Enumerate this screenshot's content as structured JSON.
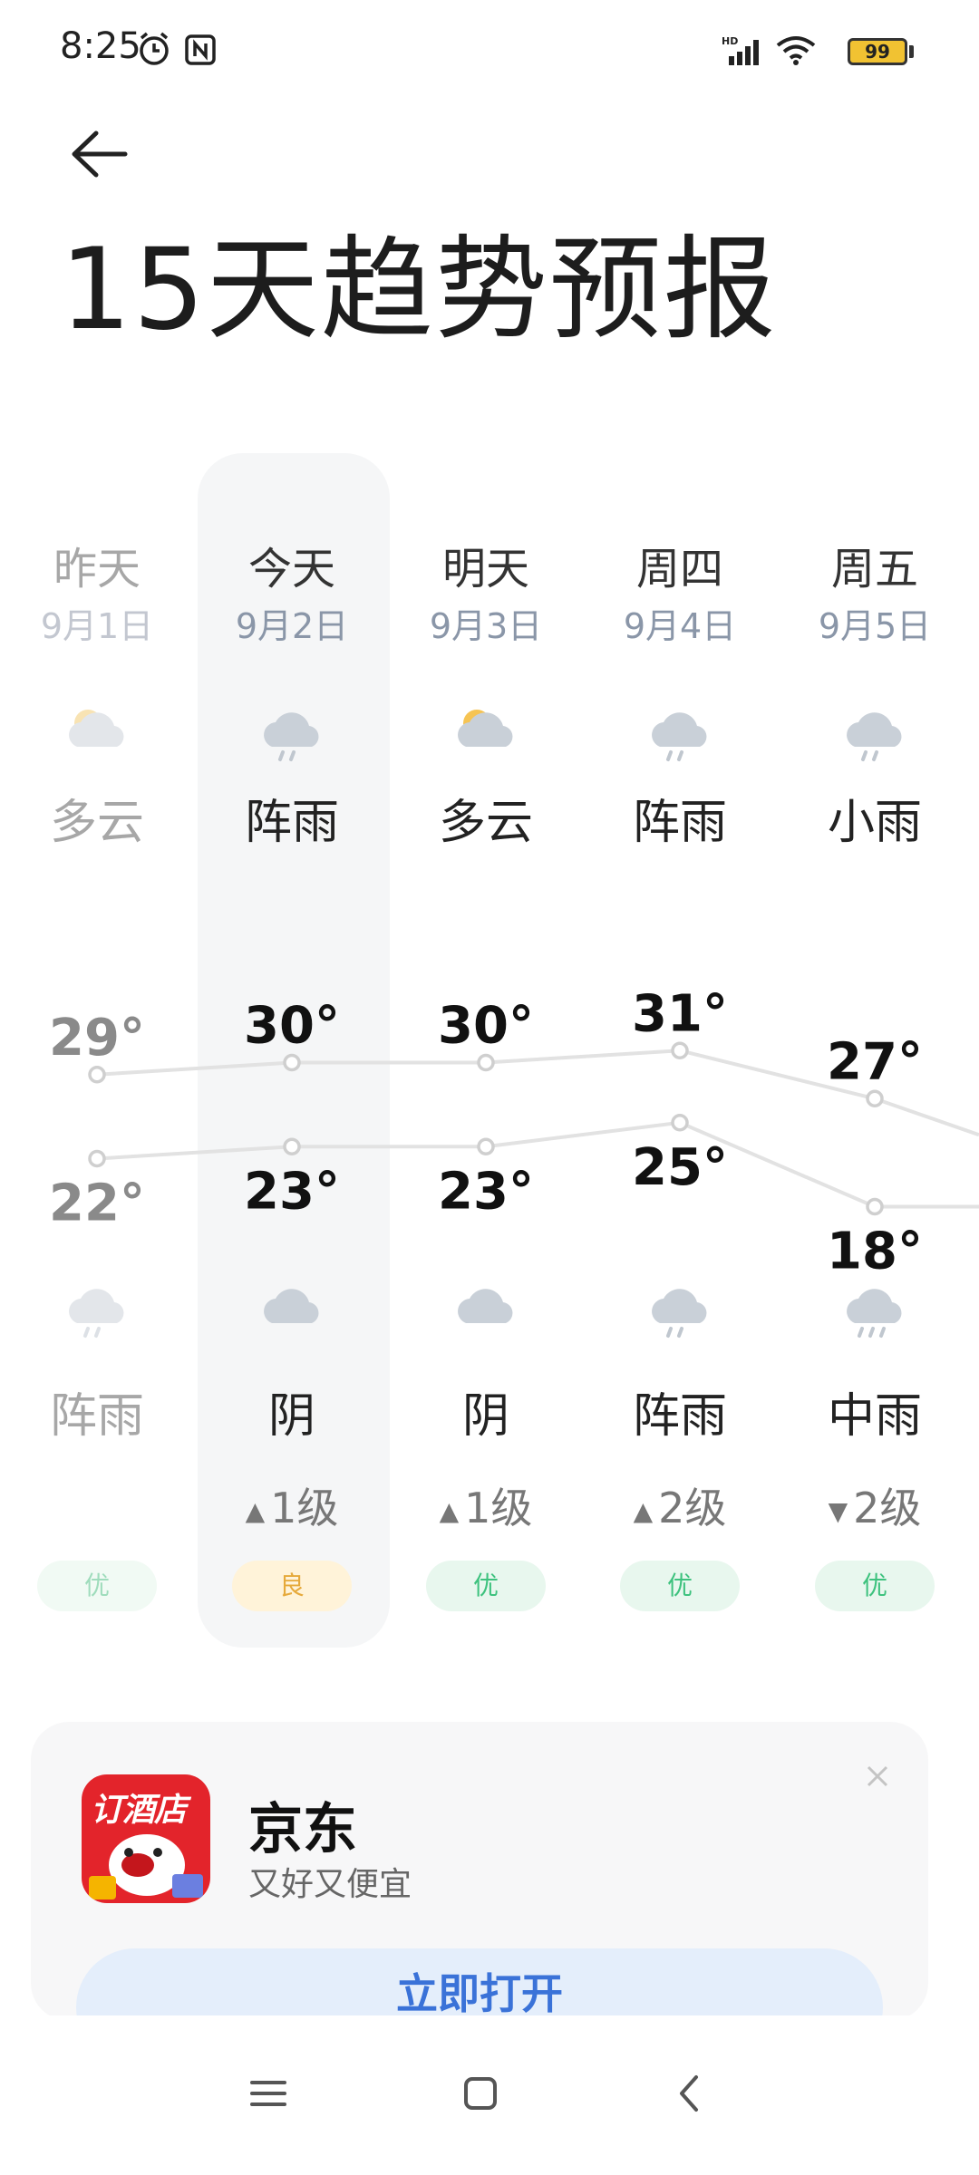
{
  "status_bar": {
    "time": "8:25",
    "battery": "99",
    "icons": [
      "alarm-icon",
      "nfc-icon",
      "signal-icon",
      "wifi-icon",
      "battery-icon"
    ]
  },
  "header": {
    "back_icon": "arrow-left-icon",
    "title": "15天趋势预报"
  },
  "forecast": {
    "days": [
      {
        "name": "昨天",
        "date": "9月1日",
        "day_condition": "多云",
        "day_icon": "partly-cloudy-icon",
        "high": "29°",
        "low": "22°",
        "night_icon": "rain-icon",
        "night_condition": "阵雨",
        "wind": "",
        "aqi": "优"
      },
      {
        "name": "今天",
        "date": "9月2日",
        "day_condition": "阵雨",
        "day_icon": "rain-icon",
        "high": "30°",
        "low": "23°",
        "night_icon": "cloudy-icon",
        "night_condition": "阴",
        "wind": "1级",
        "wind_dir": "▲",
        "aqi": "良"
      },
      {
        "name": "明天",
        "date": "9月3日",
        "day_condition": "多云",
        "day_icon": "partly-cloudy-icon",
        "high": "30°",
        "low": "23°",
        "night_icon": "cloudy-icon",
        "night_condition": "阴",
        "wind": "1级",
        "wind_dir": "▲",
        "aqi": "优"
      },
      {
        "name": "周四",
        "date": "9月4日",
        "day_condition": "阵雨",
        "day_icon": "rain-icon",
        "high": "31°",
        "low": "25°",
        "night_icon": "rain-icon",
        "night_condition": "阵雨",
        "wind": "2级",
        "wind_dir": "▲",
        "aqi": "优"
      },
      {
        "name": "周五",
        "date": "9月5日",
        "day_condition": "小雨",
        "day_icon": "rain-icon",
        "high": "27°",
        "low": "18°",
        "night_icon": "heavy-rain-icon",
        "night_condition": "中雨",
        "wind": "2级",
        "wind_dir": "▼",
        "aqi": "优"
      }
    ]
  },
  "chart_data": {
    "type": "line",
    "categories": [
      "昨天",
      "今天",
      "明天",
      "周四",
      "周五"
    ],
    "series": [
      {
        "name": "",
        "values": [
          29,
          30,
          30,
          31,
          27
        ]
      },
      {
        "name": "",
        "values": [
          22,
          23,
          23,
          25,
          18
        ]
      }
    ]
  },
  "ad": {
    "logo_text": "订酒店",
    "title": "京东",
    "subtitle": "又好又便宜",
    "button": "立即打开",
    "close_icon": "close-icon"
  },
  "nav": {
    "icons": [
      "menu-icon",
      "home-icon",
      "back-icon"
    ]
  }
}
